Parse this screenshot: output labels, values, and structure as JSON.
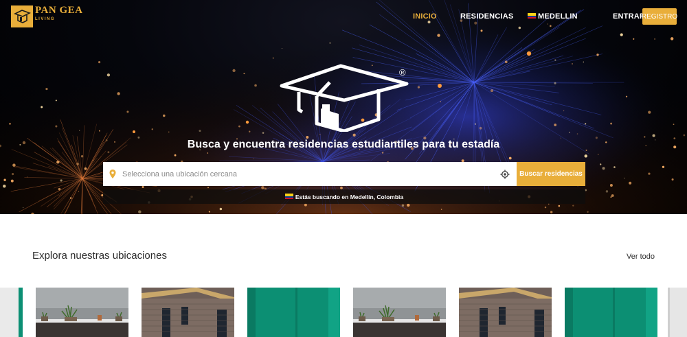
{
  "brand": {
    "name": "PAN GEA",
    "sub": "LIVING",
    "accent": "#e9ae3a"
  },
  "nav": {
    "links": [
      {
        "label": "INICIO",
        "active": true
      },
      {
        "label": "RESIDENCIAS",
        "active": false
      },
      {
        "label": "MEDELLIN",
        "flag": "colombia-flag-icon"
      }
    ],
    "login": "ENTRAR",
    "register": "REGISTRO"
  },
  "hero": {
    "registered_mark": "®",
    "title": "Busca y encuentra residencias estudiantiles para tu estadía",
    "search_placeholder": "Selecciona una ubicación cercana",
    "search_button": "Buscar residencias",
    "location_notice": "Estás buscando en Medellín, Colombia"
  },
  "locations": {
    "title": "Explora nuestras ubicaciones",
    "view_all": "Ver todo",
    "cards": [
      {
        "image": "rooftop-plants"
      },
      {
        "image": "brick-building"
      },
      {
        "image": "green-facade"
      },
      {
        "image": "rooftop-plants"
      },
      {
        "image": "brick-building"
      },
      {
        "image": "green-facade"
      }
    ]
  }
}
